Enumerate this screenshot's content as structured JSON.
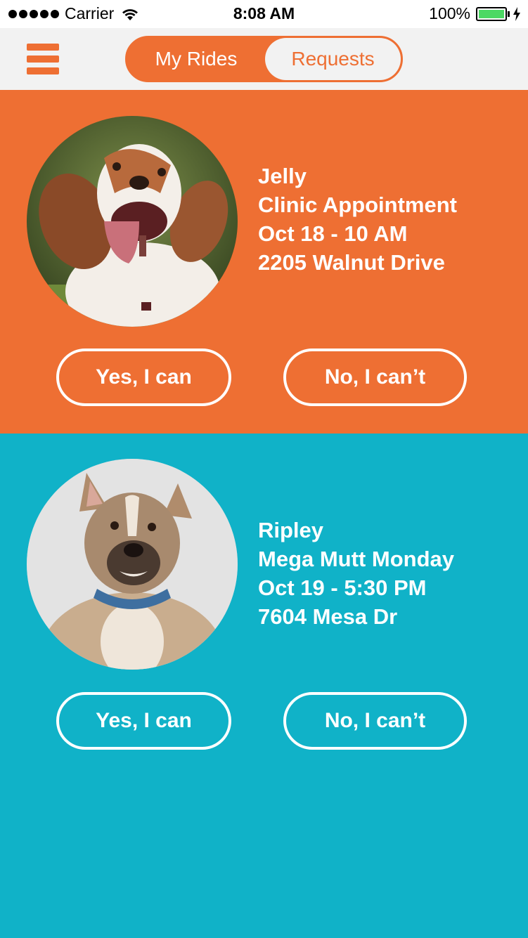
{
  "status_bar": {
    "carrier": "Carrier",
    "time": "8:08 AM",
    "battery": "100%"
  },
  "nav": {
    "tabs": [
      {
        "label": "My Rides",
        "selected": false
      },
      {
        "label": "Requests",
        "selected": true
      }
    ],
    "menu_icon": "hamburger-menu-icon"
  },
  "requests": [
    {
      "name": "Jelly",
      "event": "Clinic Appointment",
      "datetime": "Oct 18 - 10 AM",
      "address": "2205 Walnut Drive",
      "yes_label": "Yes, I can",
      "no_label": "No, I can’t",
      "card_color": "#ee6f33"
    },
    {
      "name": "Ripley",
      "event": "Mega Mutt Monday",
      "datetime": "Oct 19 - 5:30 PM",
      "address": "7604 Mesa Dr",
      "yes_label": "Yes, I can",
      "no_label": "No, I can’t",
      "card_color": "#10b2c8"
    }
  ],
  "colors": {
    "accent_orange": "#ee6f33",
    "accent_teal": "#10b2c8",
    "nav_bg": "#f2f2f2",
    "battery_green": "#4cd964"
  }
}
